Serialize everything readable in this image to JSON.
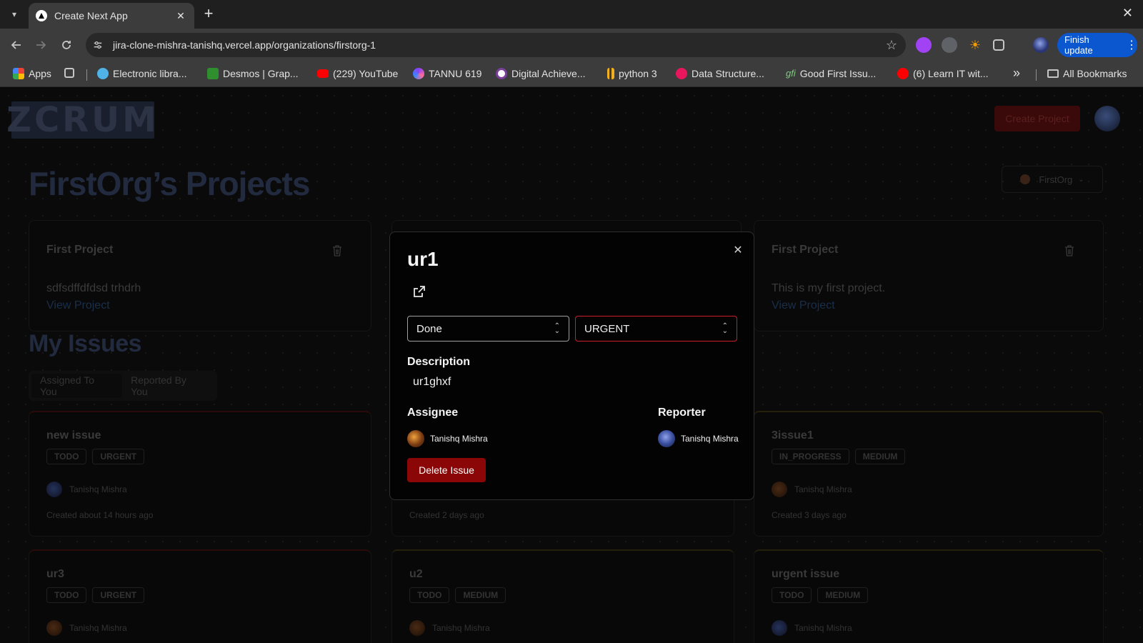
{
  "browser": {
    "tab_title": "Create Next App",
    "url": "jira-clone-mishra-tanishq.vercel.app/organizations/firstorg-1",
    "finish_update_label": "Finish update",
    "bookmarks": [
      {
        "label": "Apps"
      },
      {
        "label": "Electronic libra..."
      },
      {
        "label": "Desmos | Grap..."
      },
      {
        "label": "(229) YouTube"
      },
      {
        "label": "TANNU 619"
      },
      {
        "label": "Digital Achieve..."
      },
      {
        "label": "python 3"
      },
      {
        "label": "Data Structure..."
      },
      {
        "label": "Good First Issu..."
      },
      {
        "label": "(6) Learn IT wit..."
      }
    ],
    "more_bookmarks": "»",
    "all_bookmarks_label": "All Bookmarks"
  },
  "app": {
    "logo_text": "ZCRUM",
    "create_project_label": "Create Project",
    "page_title": "FirstOrg’s Projects",
    "org_switcher_label": "FirstOrg",
    "projects": [
      {
        "title": "First Project",
        "description": "sdfsdffdfdsd trhdrh",
        "link": "View Project"
      },
      {
        "title": "First Project",
        "description": "This is my first project.",
        "link": "View Project"
      }
    ],
    "my_issues_title": "My Issues",
    "issue_tabs": [
      "Assigned To You",
      "Reported By You"
    ],
    "issues": [
      {
        "title": "new issue",
        "status": "TODO",
        "priority": "URGENT",
        "user": "Tanishq Mishra",
        "created": "Created about 14 hours ago"
      },
      {
        "title": "",
        "status": "",
        "priority": "",
        "user": "",
        "created": "Created 2 days ago"
      },
      {
        "title": "3issue1",
        "status": "IN_PROGRESS",
        "priority": "MEDIUM",
        "user": "Tanishq Mishra",
        "created": "Created 3 days ago"
      },
      {
        "title": "ur3",
        "status": "TODO",
        "priority": "URGENT",
        "user": "Tanishq Mishra",
        "created": ""
      },
      {
        "title": "u2",
        "status": "TODO",
        "priority": "MEDIUM",
        "user": "Tanishq Mishra",
        "created": ""
      },
      {
        "title": "urgent issue",
        "status": "TODO",
        "priority": "MEDIUM",
        "user": "Tanishq Mishra",
        "created": ""
      }
    ]
  },
  "modal": {
    "title": "ur1",
    "status_value": "Done",
    "priority_value": "URGENT",
    "description_label": "Description",
    "description": "ur1ghxf",
    "assignee_label": "Assignee",
    "assignee_name": "Tanishq Mishra",
    "reporter_label": "Reporter",
    "reporter_name": "Tanishq Mishra",
    "delete_label": "Delete Issue"
  },
  "colors": {
    "delete_button": "#8b0707",
    "urgent_border": "#c9202a",
    "update_button": "#0b57d0"
  }
}
